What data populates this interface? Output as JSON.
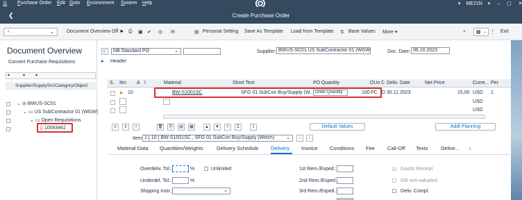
{
  "menu": {
    "items": [
      "Purchase Order",
      "Edit",
      "Goto",
      "Environment",
      "System",
      "Help"
    ],
    "transaction": "ME21N"
  },
  "title": "Create Purchase Order",
  "toolbar": {
    "doc_overview_off": "Document Overview Off",
    "personal_setting": "Personal Setting",
    "save_as_template": "Save As Template",
    "load_from_template": "Load from Template",
    "base_values": "Base Values",
    "more": "More",
    "exit": "Exit"
  },
  "left": {
    "title": "Document Overview",
    "convert": "Convert Purchase Requisitions",
    "column_header": "Supplier/SupplySrc/Category/Object",
    "tree": [
      {
        "label": "BWUS-SC01"
      },
      {
        "label": "US SubContractor 01 (WGW)"
      },
      {
        "label": "Open Requisitions"
      },
      {
        "label": "10093462"
      }
    ]
  },
  "header": {
    "doc_type": "NB Standard PO",
    "supplier_label": "Supplier:",
    "supplier_value": "BWUS-SC01 US SubContractor 01 (WGW)",
    "doc_date_label": "Doc. Date:",
    "doc_date_value": "06.10.2023",
    "header_label": "Header"
  },
  "items_grid": {
    "columns": [
      "S..",
      "Itm",
      "A",
      "I",
      "Material",
      "Short Text",
      "PO Quantity",
      "OUn",
      "C",
      "Deliv. Date",
      "Net Price",
      "Curre...",
      "Per"
    ],
    "row": {
      "itm": "10",
      "i": "L",
      "material": "BW-S1001SC",
      "short_text": "SFG 01 SubCon Buy/Supply  (W..",
      "order_qty_placeholder": "Order Quantity",
      "qty": "100",
      "oun": "PC",
      "c": "D",
      "deliv_date": "30.11.2023",
      "net_price": "15,00",
      "currency": "USD",
      "per": "1"
    },
    "empty_currency": [
      "USD",
      "USD"
    ]
  },
  "item_bar": {
    "default_values": "Default Values",
    "addl_planning": "Addl Planning",
    "item_label": "Item:",
    "item_value": "1 [ 10 ] BW-S1001SC , SFG 01 SubCon Buy/Supply (Welch)"
  },
  "tabs": [
    "Material Data",
    "Quantities/Weights",
    "Delivery Schedule",
    "Delivery",
    "Invoice",
    "Conditions",
    "Fee",
    "Call-Off",
    "Texts",
    "Delive...",
    "›"
  ],
  "delivery": {
    "overdeliv": "Overdeliv. Tol.:",
    "underdeliv": "Underdel. Tol.:",
    "shipping": "Shipping Instr.:",
    "percent": "%",
    "unlimited": "Unlimited",
    "rem1": "1st Rem./Exped.:",
    "rem2": "2nd Rem./Exped.:",
    "rem3": "3rd Rem./Exped.:",
    "goods_receipt": "Goods Receipt",
    "gr_nonvalued": "GR non-valuated",
    "deliv_compl": "Deliv. Compl."
  },
  "colors": {
    "shell": "#354a5f",
    "highlight": "#d93030",
    "link": "#0a6ed1"
  }
}
